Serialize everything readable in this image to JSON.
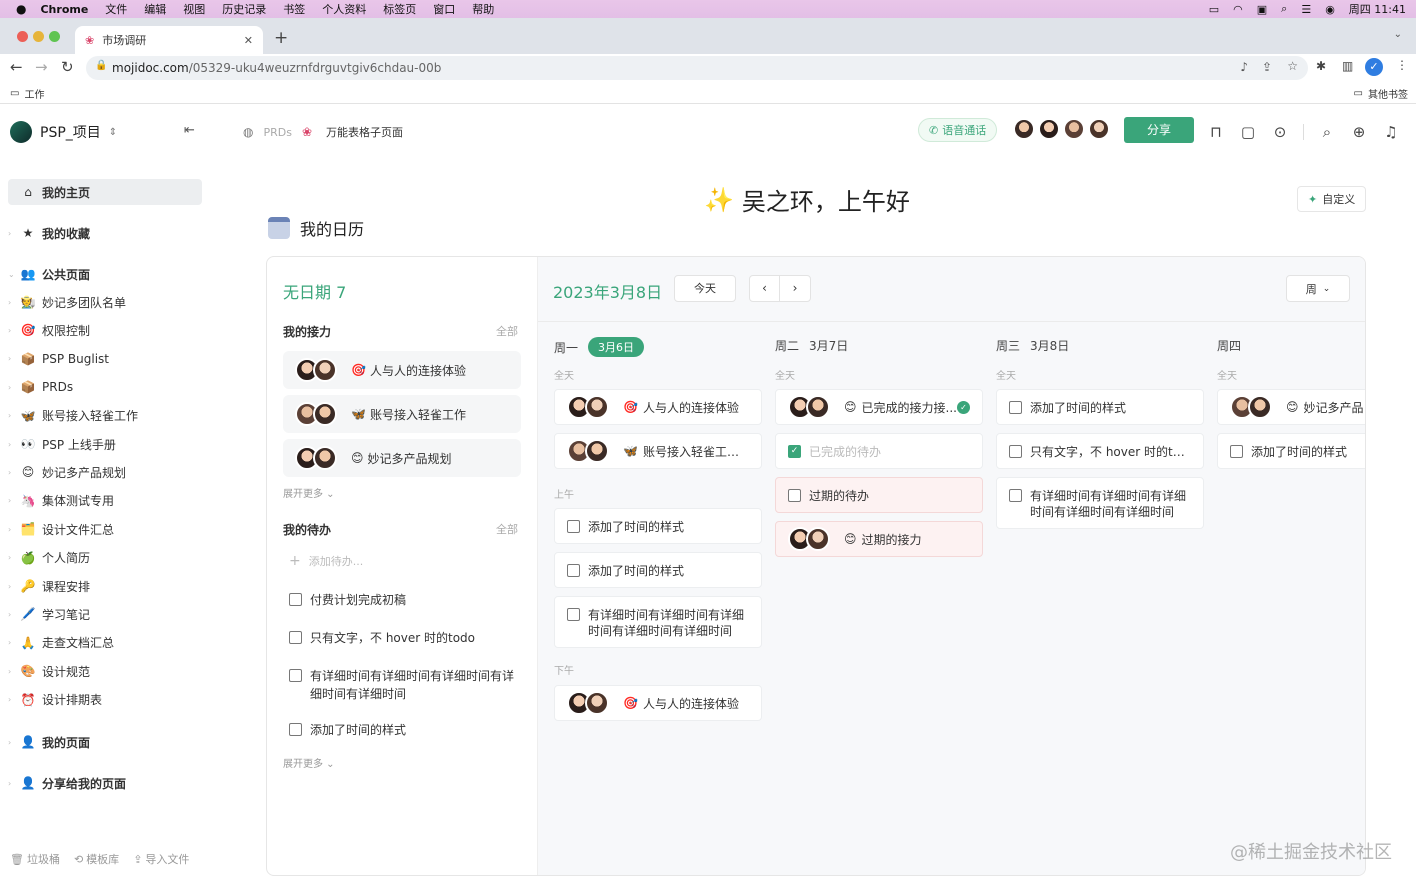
{
  "menubar": {
    "app": "Chrome",
    "items": [
      "文件",
      "编辑",
      "视图",
      "历史记录",
      "书签",
      "个人资料",
      "标签页",
      "窗口",
      "帮助"
    ],
    "clock": "周四  11:41"
  },
  "browser": {
    "tab_title": "市场调研",
    "url_domain": "mojidoc.com",
    "url_path": "/05329-uku4weuzrnfdrguvtgiv6chdau-00b",
    "bookmark_folder": "工作",
    "other_bookmarks": "其他书签"
  },
  "workspace": {
    "name": "PSP_项目"
  },
  "breadcrumb": {
    "parent": "PRDs",
    "current": "万能表格子页面"
  },
  "topbar": {
    "call_label": "语音通话",
    "share_label": "分享"
  },
  "sidebar": {
    "home": "我的主页",
    "favorites": "我的收藏",
    "public": "公共页面",
    "public_items": [
      {
        "icon": "🧑‍🌾",
        "label": "妙记多团队名单"
      },
      {
        "icon": "🎯",
        "label": "权限控制"
      },
      {
        "icon": "📦",
        "label": "PSP Buglist"
      },
      {
        "icon": "📦",
        "label": "PRDs"
      },
      {
        "icon": "🦋",
        "label": "账号接入轻雀工作"
      },
      {
        "icon": "👀",
        "label": "PSP 上线手册"
      },
      {
        "icon": "😊",
        "label": "妙记多产品规划"
      },
      {
        "icon": "🦄",
        "label": "集体测试专用"
      },
      {
        "icon": "🗂️",
        "label": "设计文件汇总"
      },
      {
        "icon": "🍏",
        "label": "个人简历"
      },
      {
        "icon": "🔑",
        "label": "课程安排"
      },
      {
        "icon": "🖊️",
        "label": "学习笔记"
      },
      {
        "icon": "🙏",
        "label": "走查文档汇总"
      },
      {
        "icon": "🎨",
        "label": "设计规范"
      },
      {
        "icon": "⏰",
        "label": "设计排期表"
      }
    ],
    "my_pages": "我的页面",
    "shared_pages": "分享给我的页面",
    "footer": {
      "trash": "垃圾桶",
      "templates": "模板库",
      "import": "导入文件"
    }
  },
  "greeting": {
    "emoji": "✨",
    "text": "吴之环，上午好",
    "customize": "自定义"
  },
  "calendar": {
    "title": "我的日历",
    "no_date_label": "无日期 7",
    "relay_section": "我的接力",
    "all_label": "全部",
    "relays": [
      {
        "emoji": "🎯",
        "label": "人与人的连接体验"
      },
      {
        "emoji": "🦋",
        "label": "账号接入轻雀工作"
      },
      {
        "emoji": "😊",
        "label": "妙记多产品规划"
      }
    ],
    "expand_more": "展开更多 ⌄",
    "todo_section": "我的待办",
    "add_todo": "添加待办...",
    "todos": [
      "付费计划完成初稿",
      "只有文字，不 hover 时的todo",
      "有详细时间有详细时间有详细时间有详细时间有详细时间",
      "添加了时间的样式"
    ],
    "current_date": "2023年3月8日",
    "today_btn": "今天",
    "view_select": "周",
    "zones": {
      "allday": "全天",
      "morning": "上午",
      "afternoon": "下午"
    },
    "days": [
      {
        "weekday": "周一",
        "date": "3月6日"
      },
      {
        "weekday": "周二",
        "date": "3月7日"
      },
      {
        "weekday": "周三",
        "date": "3月8日"
      },
      {
        "weekday": "周四",
        "date": ""
      }
    ],
    "events": {
      "mon_allday_1": "人与人的连接体验",
      "mon_allday_2": "账号接入轻雀工作d...",
      "mon_am_1": "添加了时间的样式",
      "mon_am_2": "添加了时间的样式",
      "mon_am_3": "有详细时间有详细时间有详细时间有详细时间有详细时间",
      "mon_pm_1": "人与人的连接体验",
      "tue_allday_1": "已完成的接力接...",
      "tue_allday_2": "已完成的待办",
      "tue_am_1": "过期的待办",
      "tue_am_2": "过期的接力",
      "wed_allday_1": "添加了时间的样式",
      "wed_allday_2": "只有文字，不 hover 时的todo",
      "wed_allday_3": "有详细时间有详细时间有详细时间有详细时间有详细时间",
      "thu_allday_1": "妙记多产品规",
      "thu_allday_2": "添加了时间的样式"
    }
  },
  "watermark": "@稀土掘金技术社区",
  "colors": {
    "accent": "#3aa57a",
    "overdue_bg": "#fdf2f2"
  }
}
